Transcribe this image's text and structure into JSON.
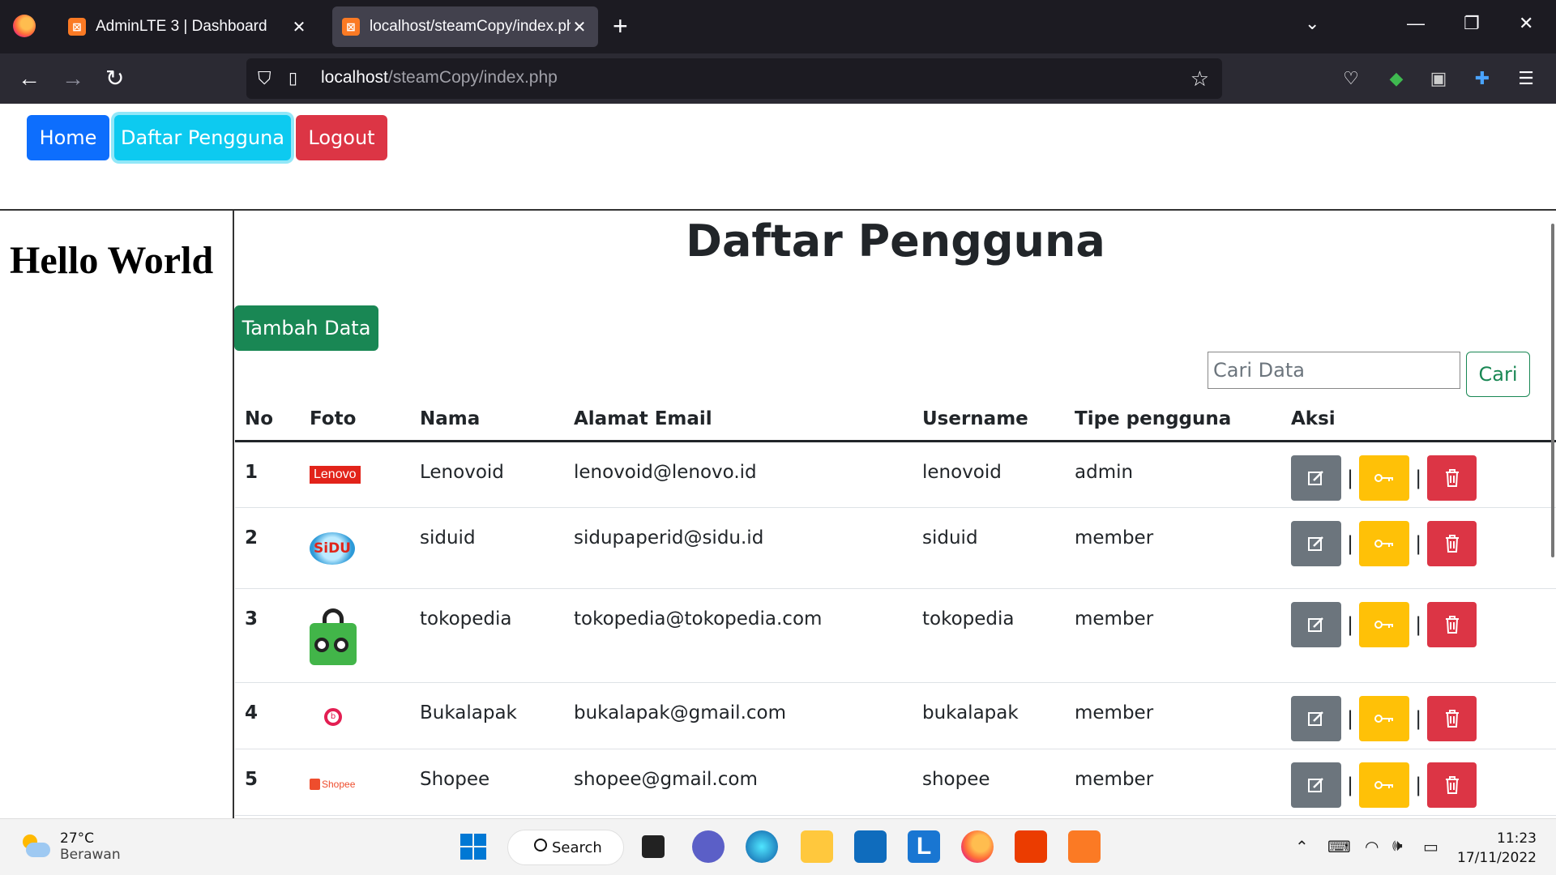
{
  "browser": {
    "tabs": [
      {
        "label": "AdminLTE 3 | Dashboard",
        "active": false
      },
      {
        "label": "localhost/steamCopy/index.php",
        "active": true
      }
    ],
    "url_host": "localhost",
    "url_path": "/steamCopy/index.php"
  },
  "nav": {
    "home": "Home",
    "daftar": "Daftar Pengguna",
    "logout": "Logout"
  },
  "sidebar": {
    "title": "Hello World"
  },
  "main": {
    "title": "Daftar Pengguna",
    "add_button": "Tambah Data",
    "search_placeholder": "Cari Data",
    "search_button": "Cari"
  },
  "table": {
    "headers": [
      "No",
      "Foto",
      "Nama",
      "Alamat Email",
      "Username",
      "Tipe pengguna",
      "Aksi"
    ],
    "rows": [
      {
        "no": "1",
        "logo": "Lenovo",
        "nama": "Lenovoid",
        "email": "lenovoid@lenovo.id",
        "username": "lenovoid",
        "tipe": "admin"
      },
      {
        "no": "2",
        "logo": "SiDU",
        "nama": "siduid",
        "email": "sidupaperid@sidu.id",
        "username": "siduid",
        "tipe": "member"
      },
      {
        "no": "3",
        "logo": "tokopedia",
        "nama": "tokopedia",
        "email": "tokopedia@tokopedia.com",
        "username": "tokopedia",
        "tipe": "member"
      },
      {
        "no": "4",
        "logo": "bukalapak",
        "nama": "Bukalapak",
        "email": "bukalapak@gmail.com",
        "username": "bukalapak",
        "tipe": "member"
      },
      {
        "no": "5",
        "logo": "Shopee",
        "nama": "Shopee",
        "email": "shopee@gmail.com",
        "username": "shopee",
        "tipe": "member"
      }
    ]
  },
  "taskbar": {
    "temperature": "27°C",
    "weather": "Berawan",
    "search": "Search",
    "time": "11:23",
    "date": "17/11/2022"
  },
  "colors": {
    "primary": "#0d6efd",
    "info": "#0dcaf0",
    "danger": "#dc3545",
    "success": "#198754",
    "secondary": "#6c757d",
    "warning": "#ffc107"
  }
}
